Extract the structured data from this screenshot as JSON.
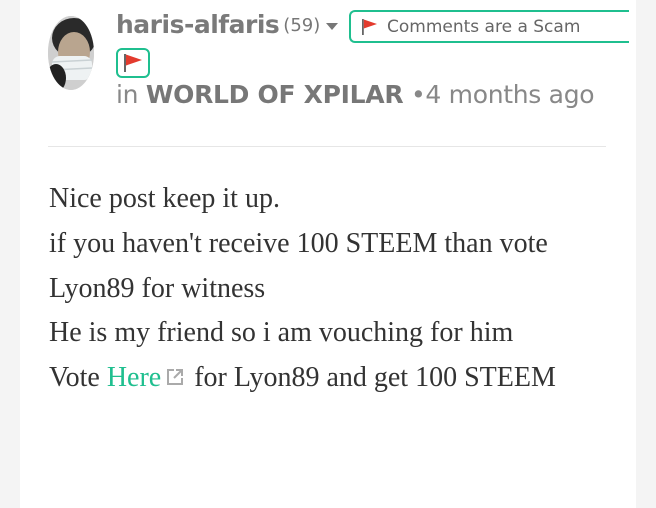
{
  "comment": {
    "author": "haris-alfaris",
    "reputation": "(59)",
    "flag_label": "Comments are a Scam",
    "meta_prefix": "in",
    "community": "WORLD OF XPILAR",
    "separator": "•",
    "time_ago": "4 months ago",
    "body": {
      "line1": "Nice post keep it up.",
      "line2": "if you haven't receive 100 STEEM than vote Lyon89 for witness",
      "line3": "He is my friend so i am vouching for him",
      "line4_before": "Vote ",
      "link_text": "Here",
      "line4_after": " for Lyon89 and get 100 STEEM"
    }
  },
  "icons": {
    "flag": "red-flag-icon",
    "external_link": "external-link-icon",
    "dropdown": "chevron-down-icon"
  },
  "colors": {
    "accent": "#1fbf8f",
    "flag_red": "#e33b2e",
    "text": "#333333",
    "muted": "#7a7a7a"
  }
}
